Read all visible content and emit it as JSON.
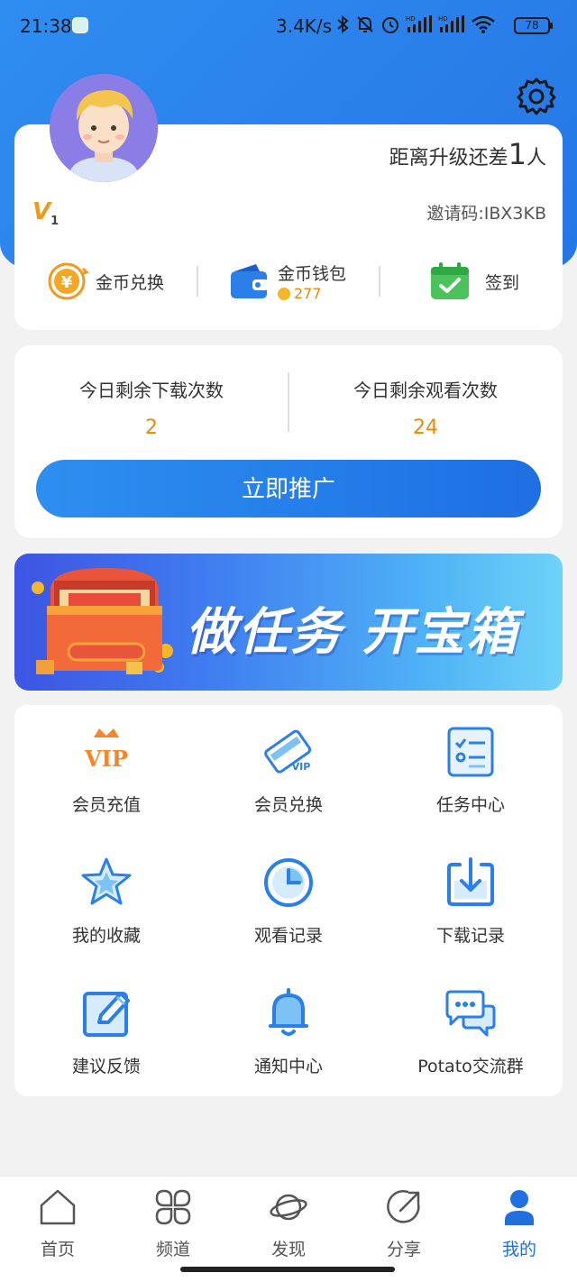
{
  "status_bar": {
    "time": "21:38",
    "net_speed": "3.4K/s",
    "battery": "78"
  },
  "profile": {
    "upgrade_prefix": "距离升级还差",
    "upgrade_count": "1",
    "upgrade_suffix": "人",
    "level_letter": "V",
    "level_number": "1",
    "invite_code": "邀请码:IBX3KB"
  },
  "quick_actions": {
    "exchange_label": "金币兑换",
    "wallet_label": "金币钱包",
    "wallet_balance": "277",
    "checkin_label": "签到"
  },
  "stats": {
    "download_label": "今日剩余下载次数",
    "download_value": "2",
    "watch_label": "今日剩余观看次数",
    "watch_value": "24",
    "promote_button": "立即推广"
  },
  "banner": {
    "text": "做任务 开宝箱"
  },
  "grid": [
    {
      "label": "会员充值",
      "icon": "vip-crown-icon"
    },
    {
      "label": "会员兑换",
      "icon": "vip-card-icon"
    },
    {
      "label": "任务中心",
      "icon": "task-list-icon"
    },
    {
      "label": "我的收藏",
      "icon": "star-icon"
    },
    {
      "label": "观看记录",
      "icon": "clock-icon"
    },
    {
      "label": "下载记录",
      "icon": "download-icon"
    },
    {
      "label": "建议反馈",
      "icon": "edit-icon"
    },
    {
      "label": "通知中心",
      "icon": "bell-icon"
    },
    {
      "label": "Potato交流群",
      "icon": "chat-icon"
    }
  ],
  "tabs": [
    {
      "label": "首页",
      "icon": "home-icon"
    },
    {
      "label": "频道",
      "icon": "channel-icon"
    },
    {
      "label": "发现",
      "icon": "planet-icon"
    },
    {
      "label": "分享",
      "icon": "share-icon"
    },
    {
      "label": "我的",
      "icon": "user-icon"
    }
  ],
  "colors": {
    "primary": "#2a7fea",
    "accent_orange": "#e58b0c",
    "active_tab": "#1f6fe0"
  }
}
